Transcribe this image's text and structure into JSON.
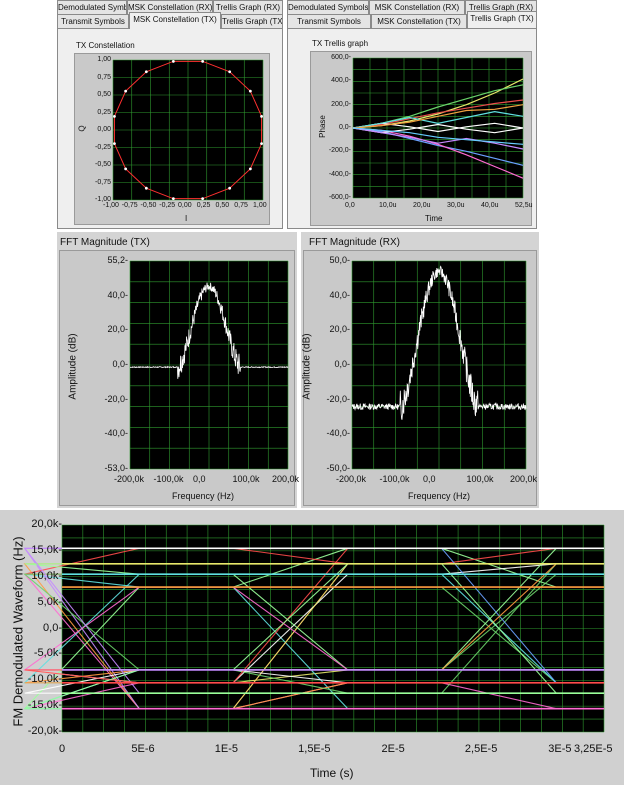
{
  "left_tabs": {
    "back_row": [
      "Demodulated Symbols",
      "MSK Constellation (RX)",
      "Trellis Graph (RX)"
    ],
    "front_row": [
      "Transmit Symbols",
      "MSK Constellation (TX)",
      "Trellis Graph (TX)"
    ],
    "active": "MSK Constellation (TX)"
  },
  "right_tabs": {
    "back_row": [
      "Demodulated Symbols",
      "MSK Constellation (RX)",
      "Trellis Graph (RX)"
    ],
    "front_row": [
      "Transmit Symbols",
      "MSK Constellation (TX)",
      "Trellis Graph (TX)"
    ],
    "active": "Trellis Graph (TX)"
  },
  "colors": {
    "plot_bg": "#000000",
    "grid": "#2f9a2f",
    "panel": "#d4d4d4",
    "constellation_line": "#ff3030",
    "fft_trace": "#ffffff"
  },
  "chart_data": [
    {
      "id": "constellation",
      "type": "scatter",
      "title": "TX Constellation",
      "xlabel": "I",
      "ylabel": "Q",
      "xlim": [
        -1.0,
        1.0
      ],
      "ylim": [
        -1.0,
        1.0
      ],
      "x_ticks": [
        "-1,00",
        "-0,75",
        "-0,50",
        "-0,25",
        "0,00",
        "0,25",
        "0,50",
        "0,75",
        "1,00"
      ],
      "y_ticks": [
        "1,00",
        "0,75",
        "0,50",
        "0,25",
        "0,00",
        "-0,25",
        "-0,50",
        "-0,75",
        "-1,00"
      ],
      "shape": "16-point circle of unit radius joined by line segments",
      "points": 16,
      "radius": 1.0
    },
    {
      "id": "trellis",
      "type": "line",
      "title": "TX Trellis graph",
      "xlabel": "Time",
      "ylabel": "Phase",
      "xlim": [
        0,
        52.5
      ],
      "ylim": [
        -600,
        600
      ],
      "x_ticks": [
        "0,0",
        "10,0u",
        "20,0u",
        "30,0u",
        "40,0u",
        "52,5u"
      ],
      "y_ticks": [
        "600,0-",
        "400,0-",
        "200,0-",
        "0,0-",
        "-200,0-",
        "-400,0-",
        "-600,0-"
      ],
      "paths": [
        {
          "color": "#e7e76a",
          "values": [
            0,
            20,
            60,
            120,
            200,
            300,
            420
          ]
        },
        {
          "color": "#6ad26a",
          "values": [
            0,
            40,
            100,
            180,
            250,
            320,
            370
          ]
        },
        {
          "color": "#e84b4b",
          "values": [
            0,
            30,
            80,
            130,
            170,
            210,
            240
          ]
        },
        {
          "color": "#6aa0ff",
          "values": [
            0,
            -30,
            -90,
            -150,
            -200,
            -260,
            -320
          ]
        },
        {
          "color": "#ff6ad2",
          "values": [
            0,
            -20,
            -70,
            -140,
            -230,
            -330,
            -430
          ]
        },
        {
          "color": "#ffffff",
          "values": [
            0,
            40,
            10,
            -30,
            10,
            40,
            0
          ]
        },
        {
          "color": "#ffffff",
          "values": [
            0,
            -40,
            -10,
            30,
            -10,
            -40,
            0
          ]
        },
        {
          "color": "#5fe0e0",
          "values": [
            0,
            40,
            90,
            40,
            90,
            140,
            100
          ]
        },
        {
          "color": "#c58aff",
          "values": [
            0,
            -40,
            -80,
            -130,
            -90,
            -130,
            -180
          ]
        },
        {
          "color": "#f0a040",
          "values": [
            0,
            20,
            50,
            100,
            150,
            160,
            200
          ]
        },
        {
          "color": "#66ccff",
          "values": [
            0,
            -20,
            -40,
            -80,
            -100,
            -120,
            -140
          ]
        }
      ]
    },
    {
      "id": "fft_tx",
      "type": "line",
      "title": "FFT Magnitude (TX)",
      "xlabel": "Frequency (Hz)",
      "ylabel": "Amplitude (dB)",
      "xlim": [
        -200,
        200
      ],
      "ylim": [
        -53,
        55.2
      ],
      "x_ticks": [
        "-200,0k",
        "-100,0k",
        "0,0",
        "100,0k",
        "200,0k"
      ],
      "y_ticks": [
        "55,2-",
        "40,0-",
        "20,0-",
        "0,0-",
        "-20,0-",
        "-40,0-",
        "-53,0-"
      ],
      "envelope": {
        "center": 0,
        "peak": 42,
        "floor": 0,
        "shoulder_half_width": 80,
        "noise_db": 5
      }
    },
    {
      "id": "fft_rx",
      "type": "line",
      "title": "FFT Magnitude (RX)",
      "xlabel": "Frequency (Hz)",
      "ylabel": "Amplitude (dB)",
      "xlim": [
        -200,
        200
      ],
      "ylim": [
        -50,
        50
      ],
      "x_ticks": [
        "-200,0k",
        "-100,0k",
        "0,0",
        "100,0k",
        "200,0k"
      ],
      "y_ticks": [
        "50,0-",
        "40,0-",
        "20,0-",
        "0,0-",
        "-20,0-",
        "-40,0-",
        "-50,0-"
      ],
      "envelope": {
        "center": 0,
        "peak": 45,
        "floor": -20,
        "shoulder_half_width": 90,
        "noise_db": 6
      }
    },
    {
      "id": "eye",
      "type": "line",
      "title": "",
      "xlabel": "Time (s)",
      "ylabel": "FM Demodulated Waveform (Hz)",
      "xlim": [
        0,
        3.25e-05
      ],
      "ylim": [
        -20000,
        20000
      ],
      "x_ticks": [
        "0",
        "5E-6",
        "1E-5",
        "1,5E-5",
        "2E-5",
        "2,5E-5",
        "3E-5",
        "3,25E-5"
      ],
      "y_ticks": [
        "20,0k-",
        "15,0k-",
        "10,0k-",
        "5,0k-",
        "0,0-",
        "-5,0k-",
        "-10,0k-",
        "-15,0k-",
        "-20,0k-"
      ],
      "levels": [
        15500,
        12500,
        10500,
        8000,
        -8000,
        -10500,
        -12500,
        -15500
      ],
      "symbol_period": 1.25e-05,
      "first_crossing": 1.2e-06,
      "trace_colors": [
        "#ff6ad2",
        "#6ad26a",
        "#6aa0ff",
        "#ffffff",
        "#e7e76a",
        "#5fe0e0",
        "#ff9a40",
        "#c58aff",
        "#ff4b4b",
        "#9aff9a"
      ]
    }
  ]
}
